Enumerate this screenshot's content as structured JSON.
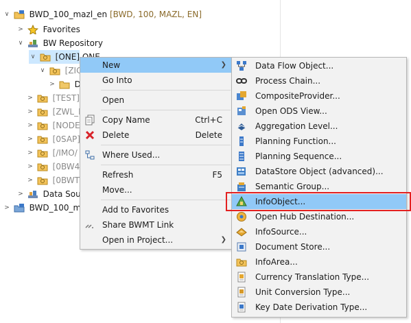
{
  "tree": {
    "items": [
      {
        "label": "BWD_100_mazl_en",
        "suffix": " [BWD, 100, MAZL, EN]"
      },
      {
        "label": "Favorites"
      },
      {
        "label": "BW Repository"
      },
      {
        "label": "[ONE] ONE"
      },
      {
        "label": "[ZIC"
      },
      {
        "label": "D"
      },
      {
        "label": "[TEST]"
      },
      {
        "label": "[ZWL_E"
      },
      {
        "label": "[NODE"
      },
      {
        "label": "[0SAP]"
      },
      {
        "label": "[/IMO/"
      },
      {
        "label": "[0BW4_"
      },
      {
        "label": "[0BWT("
      },
      {
        "label": "Data Sour"
      },
      {
        "label": "BWD_100_maz"
      }
    ]
  },
  "context_menu": {
    "items": [
      {
        "label": "New",
        "submenu": true
      },
      {
        "label": "Go Into"
      },
      {
        "label": "Open"
      },
      {
        "label": "Copy Name",
        "shortcut": "Ctrl+C"
      },
      {
        "label": "Delete",
        "shortcut": "Delete"
      },
      {
        "label": "Where Used..."
      },
      {
        "label": "Refresh",
        "shortcut": "F5"
      },
      {
        "label": "Move..."
      },
      {
        "label": "Add to Favorites"
      },
      {
        "label": "Share BWMT Link"
      },
      {
        "label": "Open in Project...",
        "submenu": true
      }
    ]
  },
  "new_submenu": {
    "items": [
      {
        "label": "Data Flow Object...",
        "icon": "data-flow-icon"
      },
      {
        "label": "Process Chain...",
        "icon": "process-chain-icon"
      },
      {
        "label": "CompositeProvider...",
        "icon": "composite-provider-icon"
      },
      {
        "label": "Open ODS View...",
        "icon": "ods-view-icon"
      },
      {
        "label": "Aggregation Level...",
        "icon": "aggregation-level-icon"
      },
      {
        "label": "Planning Function...",
        "icon": "planning-function-icon"
      },
      {
        "label": "Planning Sequence...",
        "icon": "planning-sequence-icon"
      },
      {
        "label": "DataStore Object (advanced)...",
        "icon": "datastore-icon"
      },
      {
        "label": "Semantic Group...",
        "icon": "semantic-group-icon"
      },
      {
        "label": "InfoObject...",
        "icon": "infoobject-icon",
        "highlighted": true
      },
      {
        "label": "Open Hub Destination...",
        "icon": "open-hub-icon"
      },
      {
        "label": "InfoSource...",
        "icon": "infosource-icon"
      },
      {
        "label": "Document Store...",
        "icon": "document-store-icon"
      },
      {
        "label": "InfoArea...",
        "icon": "infoarea-icon"
      },
      {
        "label": "Currency Translation Type...",
        "icon": "currency-translation-icon"
      },
      {
        "label": "Unit Conversion Type...",
        "icon": "unit-conversion-icon"
      },
      {
        "label": "Key Date Derivation Type...",
        "icon": "key-date-icon"
      }
    ]
  }
}
